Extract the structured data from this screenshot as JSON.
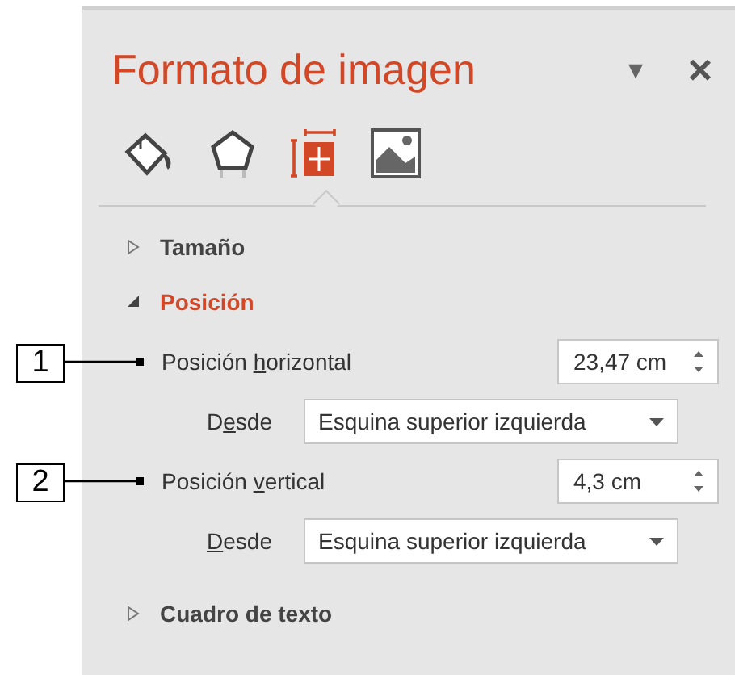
{
  "pane": {
    "title": "Formato de imagen",
    "menu_glyph": "▾",
    "close_glyph": "×"
  },
  "tabs": [
    {
      "kind": "fill",
      "selected": false
    },
    {
      "kind": "effects",
      "selected": false
    },
    {
      "kind": "size",
      "selected": true
    },
    {
      "kind": "picture",
      "selected": false
    }
  ],
  "sections": [
    {
      "label": "Tamaño",
      "expanded": false
    },
    {
      "label": "Posición",
      "expanded": true,
      "rows": [
        {
          "kind": "spinner",
          "callout": "1",
          "before": "Posición ",
          "key": "h",
          "after": "orizontal",
          "value": "23,47 cm"
        },
        {
          "kind": "dropdown",
          "before": "D",
          "key": "e",
          "after": "sde",
          "value": "Esquina superior izquierda"
        },
        {
          "kind": "spinner",
          "callout": "2",
          "before": "Posición ",
          "key": "v",
          "after": "ertical",
          "value": "4,3 cm"
        },
        {
          "kind": "dropdown",
          "before": "",
          "key": "D",
          "after": "esde",
          "value": "Esquina superior izquierda"
        }
      ]
    },
    {
      "label": "Cuadro de texto",
      "expanded": false
    }
  ]
}
